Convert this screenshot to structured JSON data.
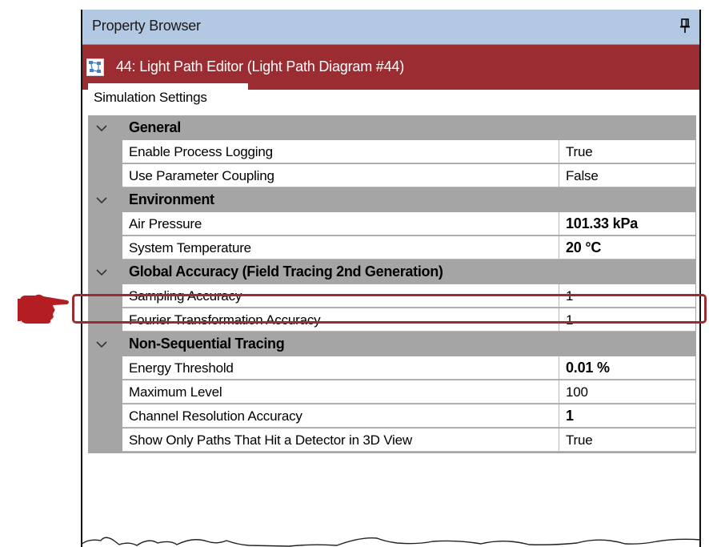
{
  "panel": {
    "title": "Property Browser",
    "document_title": "44: Light Path Editor (Light Path Diagram #44)",
    "tab_label": "Simulation Settings"
  },
  "categories": [
    {
      "label": "General",
      "properties": [
        {
          "name": "Enable Process Logging",
          "value": "True",
          "bold": false
        },
        {
          "name": "Use Parameter Coupling",
          "value": "False",
          "bold": false
        }
      ]
    },
    {
      "label": "Environment",
      "properties": [
        {
          "name": "Air Pressure",
          "value": "101.33 kPa",
          "bold": true
        },
        {
          "name": "System Temperature",
          "value": "20 °C",
          "bold": true
        }
      ]
    },
    {
      "label": "Global Accuracy (Field Tracing 2nd Generation)",
      "properties": [
        {
          "name": "Sampling Accuracy",
          "value": "1",
          "bold": false
        },
        {
          "name": "Fourier Transformation Accuracy",
          "value": "1",
          "bold": false
        }
      ]
    },
    {
      "label": "Non-Sequential Tracing",
      "properties": [
        {
          "name": "Energy Threshold",
          "value": "0.01 %",
          "bold": true
        },
        {
          "name": "Maximum Level",
          "value": "100",
          "bold": false
        },
        {
          "name": "Channel Resolution Accuracy",
          "value": "1",
          "bold": true
        },
        {
          "name": "Show Only Paths That Hit a Detector in 3D View",
          "value": "True",
          "bold": false
        }
      ]
    }
  ],
  "colors": {
    "title_bar": "#b3c8e3",
    "document_bar": "#9b2d32",
    "category_row": "#a5a5a5",
    "highlight": "#9b2d32"
  }
}
